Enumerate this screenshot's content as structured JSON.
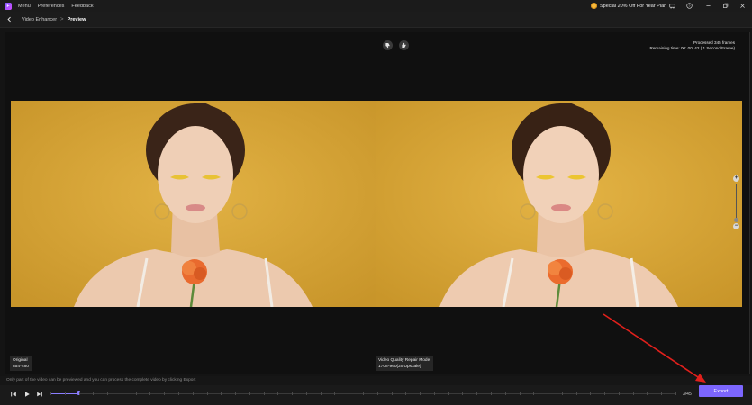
{
  "titlebar": {
    "logo_letter": "F",
    "menu_items": [
      "Menu",
      "Preferences",
      "Feedback"
    ],
    "promo_text": "Special 20% Off For Year Plan"
  },
  "navbar": {
    "breadcrumb_parent": "Video Enhancer",
    "breadcrumb_separator": ">",
    "breadcrumb_current": "Preview"
  },
  "preview": {
    "processed_line1": "Processed 345 frames",
    "processed_line2": "Remaining time: 00: 00: 42 ( 1 Second/Frame)",
    "original_label": "Original",
    "original_resolution": "854*480",
    "enhanced_label": "Video Quality Repair Model",
    "enhanced_resolution": "1708*960(2x Upscale)",
    "zoom_in": "+",
    "zoom_out": "−"
  },
  "footer": {
    "hint": "Only part of the video can be previewed and you can process the complete video by clicking Export",
    "frame_count": "3/45",
    "export_label": "Export",
    "playback_progress": 0.045
  },
  "colors": {
    "accent": "#7c66ff",
    "annotation_arrow": "#e0201c",
    "backdrop": "#d9a73a"
  }
}
